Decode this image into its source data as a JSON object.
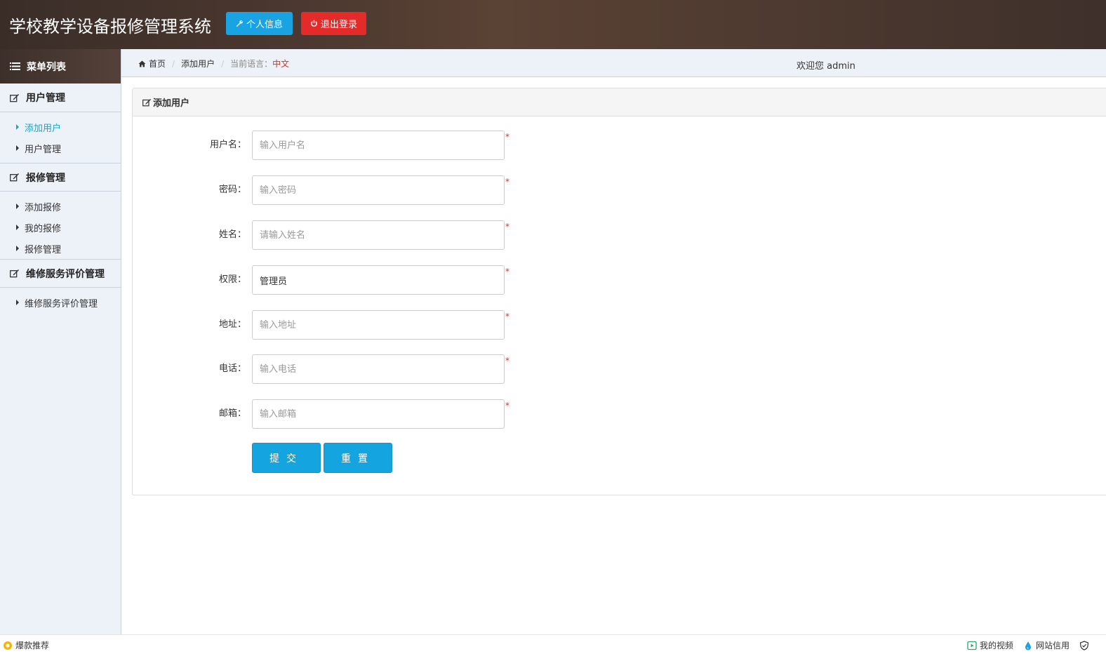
{
  "header": {
    "title": "学校教学设备报修管理系统",
    "profile_label": "个人信息",
    "logout_label": "退出登录",
    "profile_color": "#1aa3e3",
    "logout_color": "#e52a2a"
  },
  "sidebar": {
    "menu_title": "菜单列表",
    "groups": [
      {
        "title": "用户管理",
        "items": [
          {
            "label": "添加用户",
            "active": true
          },
          {
            "label": "用户管理"
          }
        ]
      },
      {
        "title": "报修管理",
        "items": [
          {
            "label": "添加报修"
          },
          {
            "label": "我的报修"
          },
          {
            "label": "报修管理"
          }
        ]
      },
      {
        "title": "维修服务评价管理",
        "items": [
          {
            "label": "维修服务评价管理"
          }
        ]
      }
    ]
  },
  "breadcrumb": {
    "home": "首页",
    "current": "添加用户",
    "lang_label": "当前语言：",
    "lang_value": "中文"
  },
  "welcome": "欢迎您 admin",
  "panel": {
    "title": "添加用户",
    "fields": [
      {
        "label": "用户名：",
        "placeholder": "输入用户名",
        "value": ""
      },
      {
        "label": "密码：",
        "placeholder": "输入密码",
        "value": ""
      },
      {
        "label": "姓名：",
        "placeholder": "请输入姓名",
        "value": ""
      },
      {
        "label": "权限：",
        "placeholder": "",
        "value": "管理员"
      },
      {
        "label": "地址：",
        "placeholder": "输入地址",
        "value": ""
      },
      {
        "label": "电话：",
        "placeholder": "输入电话",
        "value": ""
      },
      {
        "label": "邮箱：",
        "placeholder": "输入邮箱",
        "value": ""
      }
    ],
    "required_mark": "*",
    "submit_label": "提交",
    "reset_label": "重置"
  },
  "statusbar": {
    "left": "爆款推荐",
    "video": "我的视频",
    "credit": "网站信用"
  }
}
